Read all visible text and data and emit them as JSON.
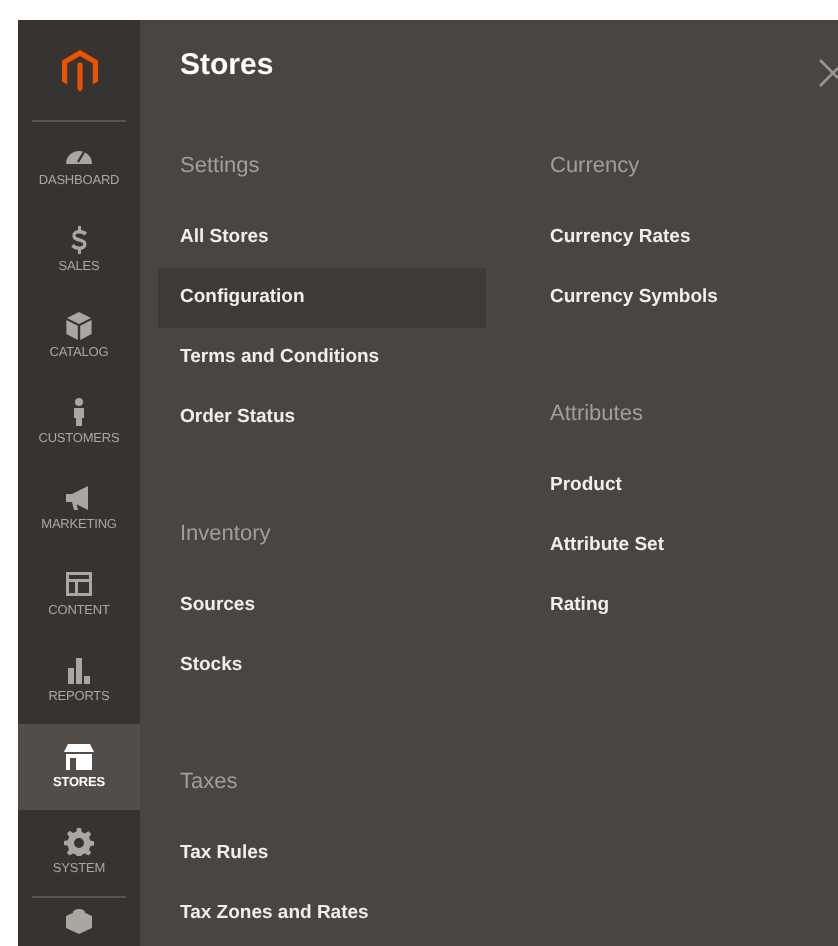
{
  "sidebar": {
    "items": [
      {
        "label": "DASHBOARD",
        "selected": false
      },
      {
        "label": "SALES",
        "selected": false
      },
      {
        "label": "CATALOG",
        "selected": false
      },
      {
        "label": "CUSTOMERS",
        "selected": false
      },
      {
        "label": "MARKETING",
        "selected": false
      },
      {
        "label": "CONTENT",
        "selected": false
      },
      {
        "label": "REPORTS",
        "selected": false
      },
      {
        "label": "STORES",
        "selected": true
      },
      {
        "label": "SYSTEM",
        "selected": false
      }
    ]
  },
  "panel": {
    "title": "Stores",
    "columns": [
      [
        {
          "heading": "Settings",
          "items": [
            {
              "label": "All Stores",
              "selected": false
            },
            {
              "label": "Configuration",
              "selected": true
            },
            {
              "label": "Terms and Conditions",
              "selected": false
            },
            {
              "label": "Order Status",
              "selected": false
            }
          ]
        },
        {
          "heading": "Inventory",
          "items": [
            {
              "label": "Sources",
              "selected": false
            },
            {
              "label": "Stocks",
              "selected": false
            }
          ]
        },
        {
          "heading": "Taxes",
          "items": [
            {
              "label": "Tax Rules",
              "selected": false
            },
            {
              "label": "Tax Zones and Rates",
              "selected": false
            }
          ]
        }
      ],
      [
        {
          "heading": "Currency",
          "items": [
            {
              "label": "Currency Rates",
              "selected": false
            },
            {
              "label": "Currency Symbols",
              "selected": false
            }
          ]
        },
        {
          "heading": "Attributes",
          "items": [
            {
              "label": "Product",
              "selected": false
            },
            {
              "label": "Attribute Set",
              "selected": false
            },
            {
              "label": "Rating",
              "selected": false
            }
          ]
        }
      ]
    ]
  }
}
